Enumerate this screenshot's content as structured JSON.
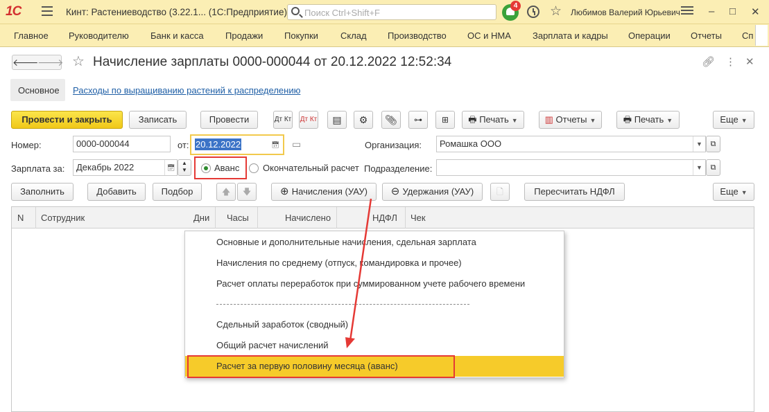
{
  "titlebar": {
    "logo": "1С",
    "app_title": "Кинт: Растениеводство (3.22.1... (1С:Предприятие)",
    "search_placeholder": "Поиск Ctrl+Shift+F",
    "notifications_count": "4",
    "user_name": "Любимов Валерий Юрьевич",
    "minimize": "–",
    "maximize": "□",
    "close": "✕"
  },
  "sections": [
    "Главное",
    "Руководителю",
    "Банк и касса",
    "Продажи",
    "Покупки",
    "Склад",
    "Производство",
    "ОС и НМА",
    "Зарплата и кадры",
    "Операции",
    "Отчеты",
    "Сп"
  ],
  "document": {
    "title": "Начисление зарплаты 0000-000044 от 20.12.2022 12:52:34",
    "tab_main": "Основное",
    "tab_link": "Расходы по выращиванию растений к распределению"
  },
  "toolbar": {
    "post_close": "Провести и закрыть",
    "save": "Записать",
    "post": "Провести",
    "dtkt1": "Дт Кт",
    "dtkt2": "Дт Кт",
    "print1": "Печать",
    "reports": "Отчеты",
    "print2": "Печать",
    "more": "Еще"
  },
  "form": {
    "number_label": "Номер:",
    "number_value": "0000-000044",
    "from_label": "от:",
    "date_value": "20.12.2022",
    "org_label": "Организация:",
    "org_value": "Ромашка ООО",
    "salary_label": "Зарплата за:",
    "salary_value": "Декабрь 2022",
    "radio_advance": "Аванс",
    "radio_final": "Окончательный расчет",
    "dept_label": "Подразделение:",
    "dept_value": ""
  },
  "table_toolbar": {
    "fill": "Заполнить",
    "add": "Добавить",
    "pick": "Подбор",
    "accruals": "Начисления (УАУ)",
    "deductions": "Удержания (УАУ)",
    "recalc": "Пересчитать НДФЛ",
    "more": "Еще"
  },
  "table": {
    "columns": [
      "N",
      "Сотрудник",
      "Дни",
      "Часы",
      "Начислено",
      "НДФЛ",
      "Чек"
    ]
  },
  "popup_menu": {
    "items": [
      "Основные и дополнительные начисления, сдельная зарплата",
      "Начисления по среднему (отпуск, командировка и прочее)",
      "Расчет оплаты переработок при суммированном учете рабочего времени",
      "Сдельный заработок (сводный)",
      "Общий расчет начислений",
      "Расчет за первую половину месяца (аванс)"
    ],
    "highlighted_index": 5
  },
  "colors": {
    "header_bg": "#fbeeb4",
    "primary_button": "#f0c818",
    "highlight": "#f6cb2a",
    "annotation_red": "#e53935",
    "link": "#1f5fa6"
  }
}
